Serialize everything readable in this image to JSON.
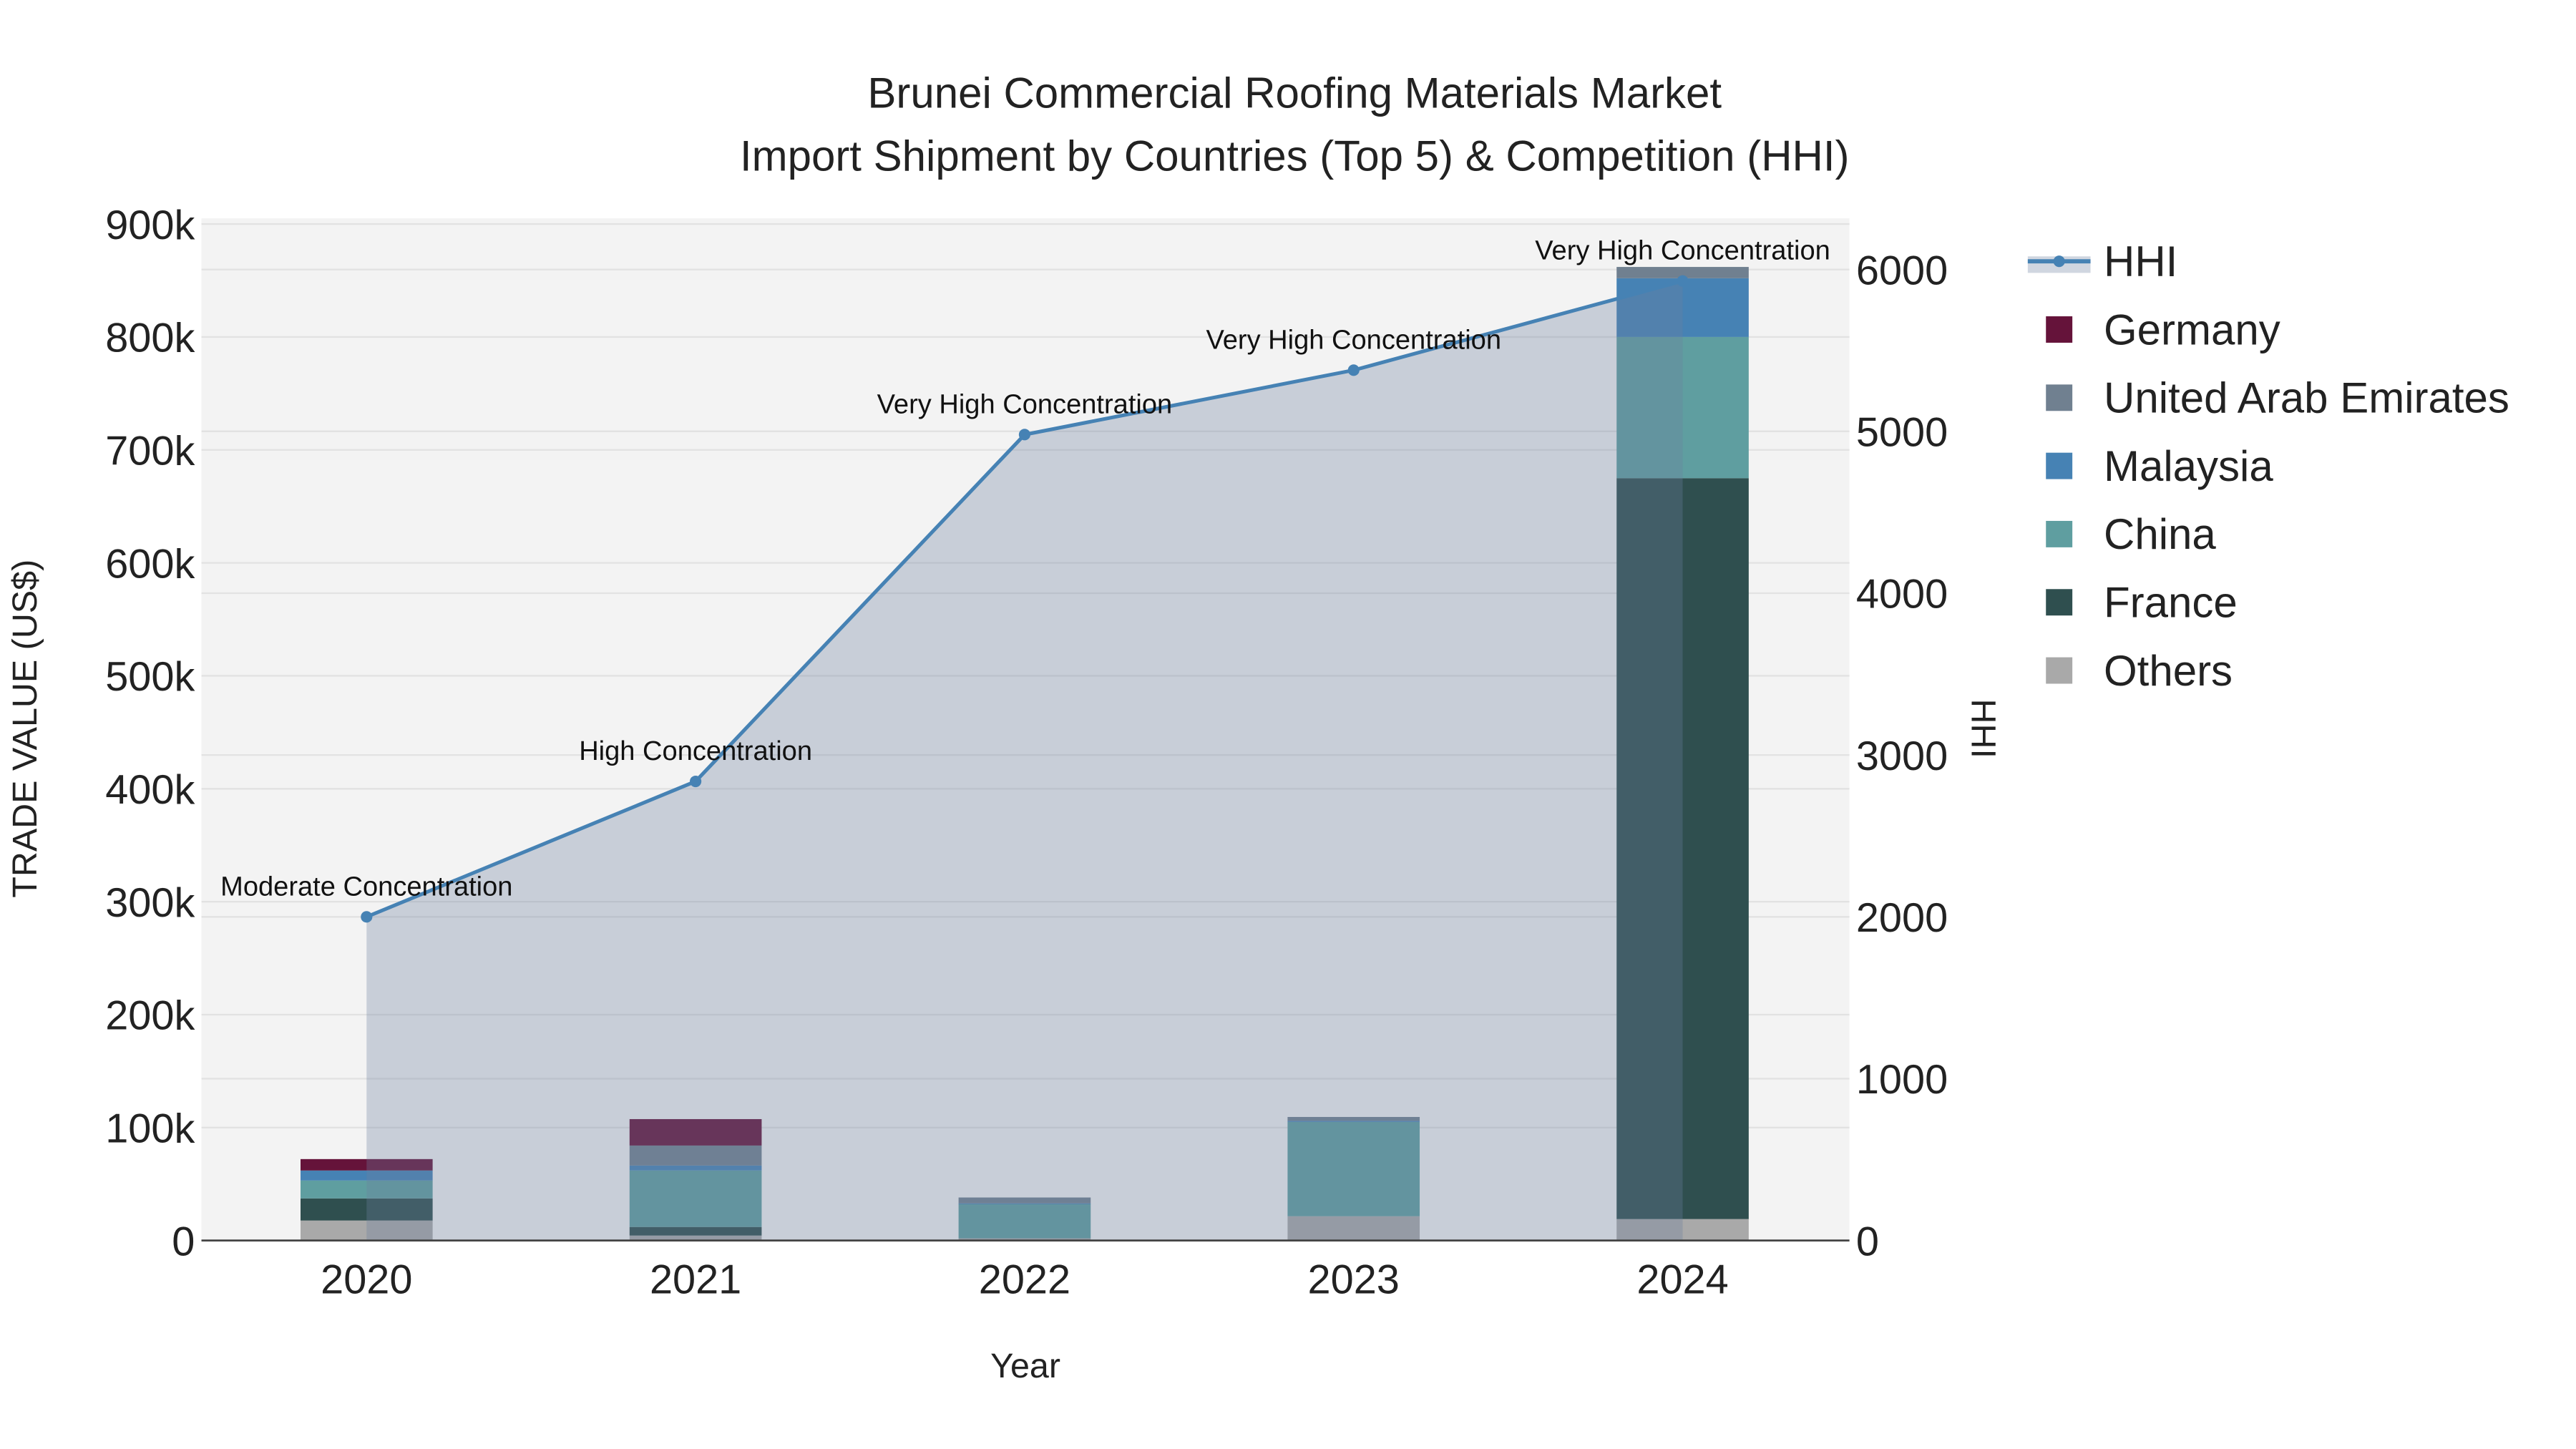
{
  "chart_data": {
    "type": "bar",
    "title_line1": "Brunei Commercial Roofing Materials Market",
    "title_line2": "Import Shipment by Countries (Top 5) & Competition (HHI)",
    "xlabel": "Year",
    "ylabel": "TRADE VALUE (US$)",
    "y2label": "HHI",
    "categories": [
      "2020",
      "2021",
      "2022",
      "2023",
      "2024"
    ],
    "ylim": [
      0,
      905000
    ],
    "y2lim": [
      0,
      6316
    ],
    "yticks": [
      0,
      100000,
      200000,
      300000,
      400000,
      500000,
      600000,
      700000,
      800000,
      900000
    ],
    "ytick_labels": [
      "0",
      "100k",
      "200k",
      "300k",
      "400k",
      "500k",
      "600k",
      "700k",
      "800k",
      "900k"
    ],
    "y2ticks": [
      0,
      1000,
      2000,
      3000,
      4000,
      5000,
      6000
    ],
    "y2tick_labels": [
      "0",
      "1000",
      "2000",
      "3000",
      "4000",
      "5000",
      "6000"
    ],
    "grid": true,
    "legend_placement": "right",
    "series": [
      {
        "name": "Others",
        "color": "#a9a9a9",
        "values": [
          17700,
          4400,
          2000,
          21500,
          19000
        ]
      },
      {
        "name": "France",
        "color": "#2f4f4f",
        "values": [
          19600,
          7600,
          0,
          0,
          656000
        ]
      },
      {
        "name": "China",
        "color": "#5f9ea0",
        "values": [
          15800,
          50000,
          30400,
          83500,
          125000
        ]
      },
      {
        "name": "Malaysia",
        "color": "#4682b4",
        "values": [
          8900,
          4400,
          500,
          1000,
          52000
        ]
      },
      {
        "name": "United Arab Emirates",
        "color": "#708090",
        "values": [
          0,
          17700,
          5200,
          3400,
          10000
        ]
      },
      {
        "name": "Germany",
        "color": "#65133a",
        "values": [
          10100,
          23400,
          0,
          0,
          0
        ]
      }
    ],
    "legend_order": [
      "HHI",
      "Germany",
      "United Arab Emirates",
      "Malaysia",
      "China",
      "France",
      "Others"
    ],
    "hhi": {
      "name": "HHI",
      "color": "#4682b4",
      "values": [
        2000,
        2837,
        4980,
        5378,
        5929
      ],
      "annotations": [
        "Moderate Concentration",
        "High Concentration",
        "Very High Concentration",
        "Very High Concentration",
        "Very High Concentration"
      ]
    }
  }
}
